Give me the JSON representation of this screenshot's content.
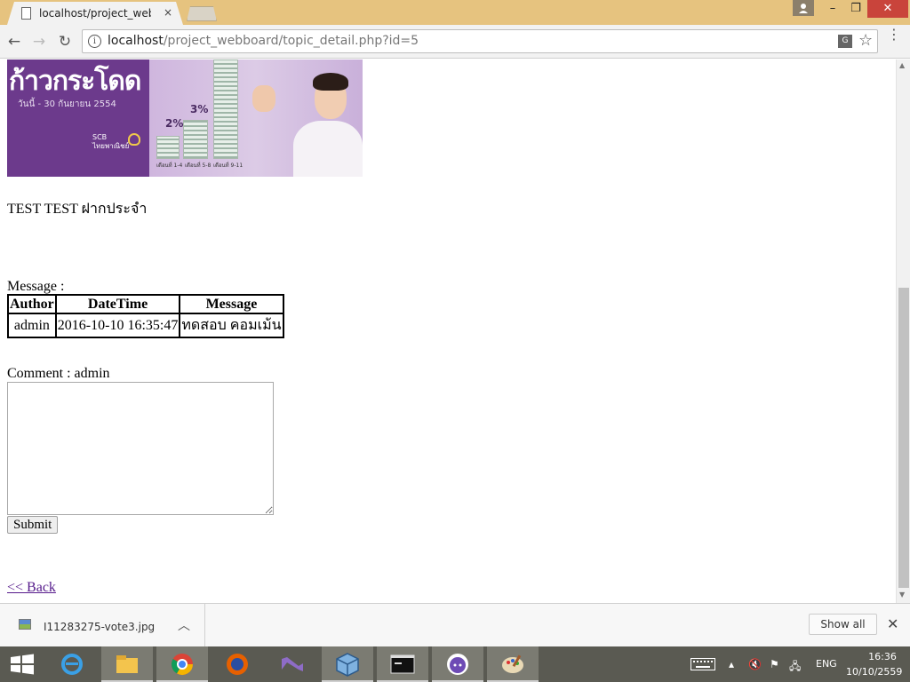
{
  "browser": {
    "tab_title": "localhost/project_webboa",
    "tab_close": "×",
    "url_host": "localhost",
    "url_path": "/project_webboard/topic_detail.php?id=5",
    "window_controls": {
      "minimize": "–",
      "maximize": "❐",
      "close": "✕"
    },
    "nav": {
      "back": "←",
      "forward": "→",
      "reload": "↻"
    }
  },
  "banner": {
    "headline": "ก้าวกระโดด",
    "date_text": "วันนี้ - 30 กันยายน 2554",
    "brand": "SCB\nไทยพาณิชย์",
    "bars": [
      {
        "label": "2%",
        "caption": "เดือนที่ 1-4"
      },
      {
        "label": "3%",
        "caption": "เดือนที่ 5-8"
      },
      {
        "label": "",
        "caption": "เดือนที่ 9-11"
      }
    ]
  },
  "topic": {
    "text": "TEST TEST ฝากประจำ"
  },
  "messages": {
    "label": "Message :",
    "headers": [
      "Author",
      "DateTime",
      "Message"
    ],
    "rows": [
      {
        "author": "admin",
        "datetime": "2016-10-10 16:35:47",
        "message": "ทดสอบ คอมเม้น"
      }
    ]
  },
  "comment": {
    "label": "Comment : admin",
    "value": "",
    "submit_label": "Submit"
  },
  "back_link": "<< Back",
  "download_shelf": {
    "filename": "I11283275-vote3.jpg",
    "show_all": "Show all",
    "close": "✕"
  },
  "taskbar": {
    "language": "ENG",
    "time": "16:36",
    "date": "10/10/2559"
  }
}
